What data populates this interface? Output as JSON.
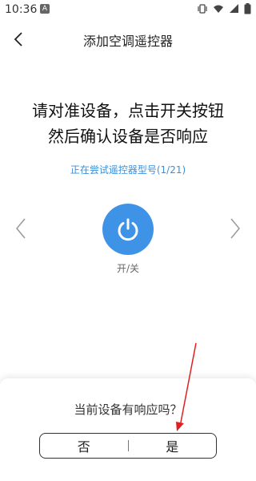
{
  "status_bar": {
    "time": "10:36",
    "notification_letter": "A",
    "icons": [
      "vibrate-icon",
      "wifi-icon",
      "signal-icon",
      "battery-icon"
    ]
  },
  "header": {
    "title": "添加空调遥控器",
    "back_icon": "chevron-left-icon"
  },
  "instruction": {
    "line1": "请对准设备，点击开关按钮",
    "line2": "然后确认设备是否响应"
  },
  "trying_status": "正在尝试遥控器型号(1/21)",
  "power": {
    "label": "开/关",
    "icon": "power-icon",
    "color": "#3f93e6"
  },
  "nav": {
    "prev_icon": "chevron-left-icon",
    "next_icon": "chevron-right-icon"
  },
  "prompt": {
    "question": "当前设备有响应吗？",
    "no_label": "否",
    "yes_label": "是"
  },
  "colors": {
    "accent": "#3f93e6",
    "link": "#3b8fd9",
    "annotation": "#e02020"
  }
}
